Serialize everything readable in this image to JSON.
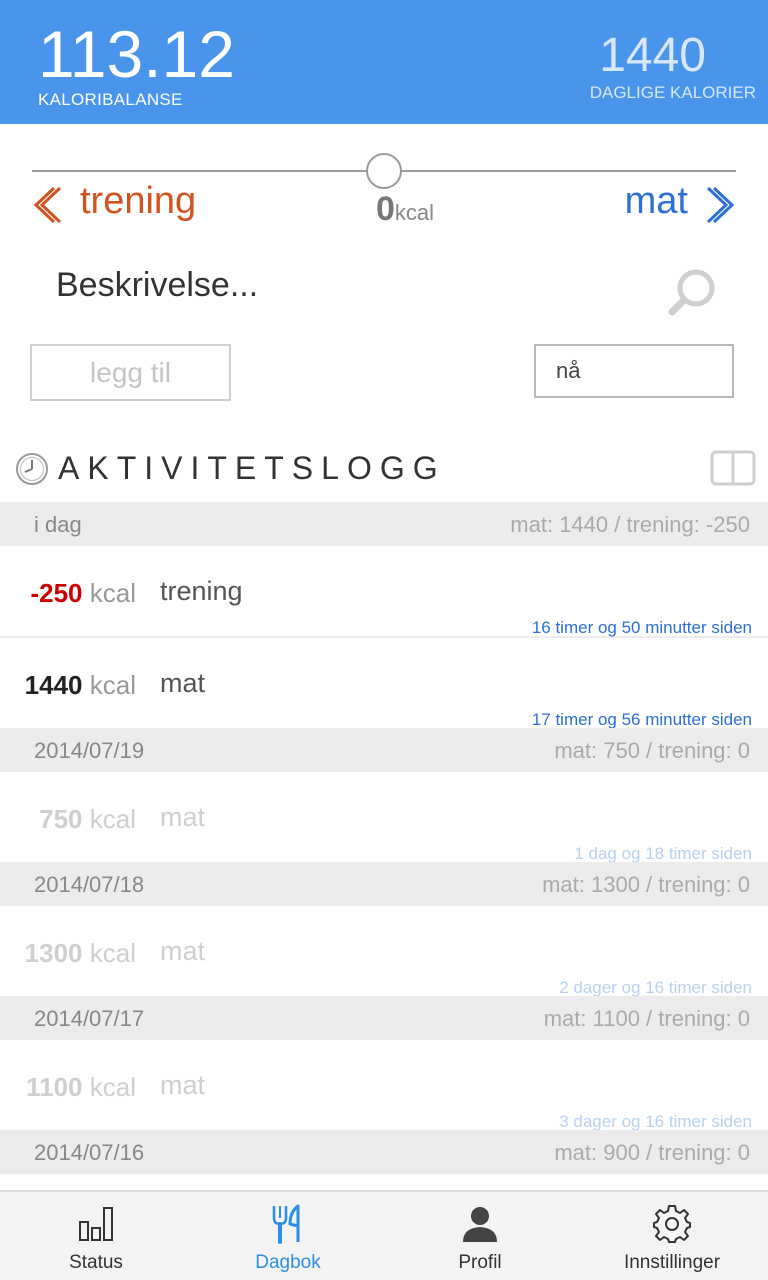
{
  "header": {
    "balance_value": "113.12",
    "balance_label": "KALORIBALANSE",
    "daily_value": "1440",
    "daily_label": "DAGLIGE KALORIER"
  },
  "entry_form": {
    "left_label": "trening",
    "right_label": "mat",
    "kcal_value": "0",
    "kcal_unit": "kcal",
    "description_placeholder": "Beskrivelse...",
    "add_button": "legg til",
    "time_value": "nå"
  },
  "activity_log": {
    "title": "AKTIVITETSLOGG",
    "days": [
      {
        "date": "i dag",
        "summary": "mat: 1440 / trening: -250",
        "entries": [
          {
            "kcal": "-250",
            "unit": "kcal",
            "kind": "trening",
            "ago": "16 timer og 50 minutter siden"
          },
          {
            "kcal": "1440",
            "unit": "kcal",
            "kind": "mat",
            "ago": "17 timer og 56 minutter siden"
          }
        ]
      },
      {
        "date": "2014/07/19",
        "summary": "mat: 750 / trening: 0",
        "entries": [
          {
            "kcal": "750",
            "unit": "kcal",
            "kind": "mat",
            "ago": "1 dag og 18 timer siden"
          }
        ]
      },
      {
        "date": "2014/07/18",
        "summary": "mat: 1300 / trening: 0",
        "entries": [
          {
            "kcal": "1300",
            "unit": "kcal",
            "kind": "mat",
            "ago": "2 dager og 16 timer siden"
          }
        ]
      },
      {
        "date": "2014/07/17",
        "summary": "mat: 1100 / trening: 0",
        "entries": [
          {
            "kcal": "1100",
            "unit": "kcal",
            "kind": "mat",
            "ago": "3 dager og 16 timer siden"
          }
        ]
      },
      {
        "date": "2014/07/16",
        "summary": "mat: 900 / trening: 0",
        "entries": []
      }
    ]
  },
  "tabs": [
    {
      "label": "Status",
      "icon": "bar-chart-icon"
    },
    {
      "label": "Dagbok",
      "icon": "fork-knife-icon"
    },
    {
      "label": "Profil",
      "icon": "person-icon"
    },
    {
      "label": "Innstillinger",
      "icon": "gear-icon"
    }
  ],
  "colors": {
    "header_blue": "#4a95ec",
    "exercise_orange": "#d1531f",
    "food_blue": "#2d6fd3",
    "negative_red": "#cc0000",
    "active_tab": "#2d8ee6"
  }
}
